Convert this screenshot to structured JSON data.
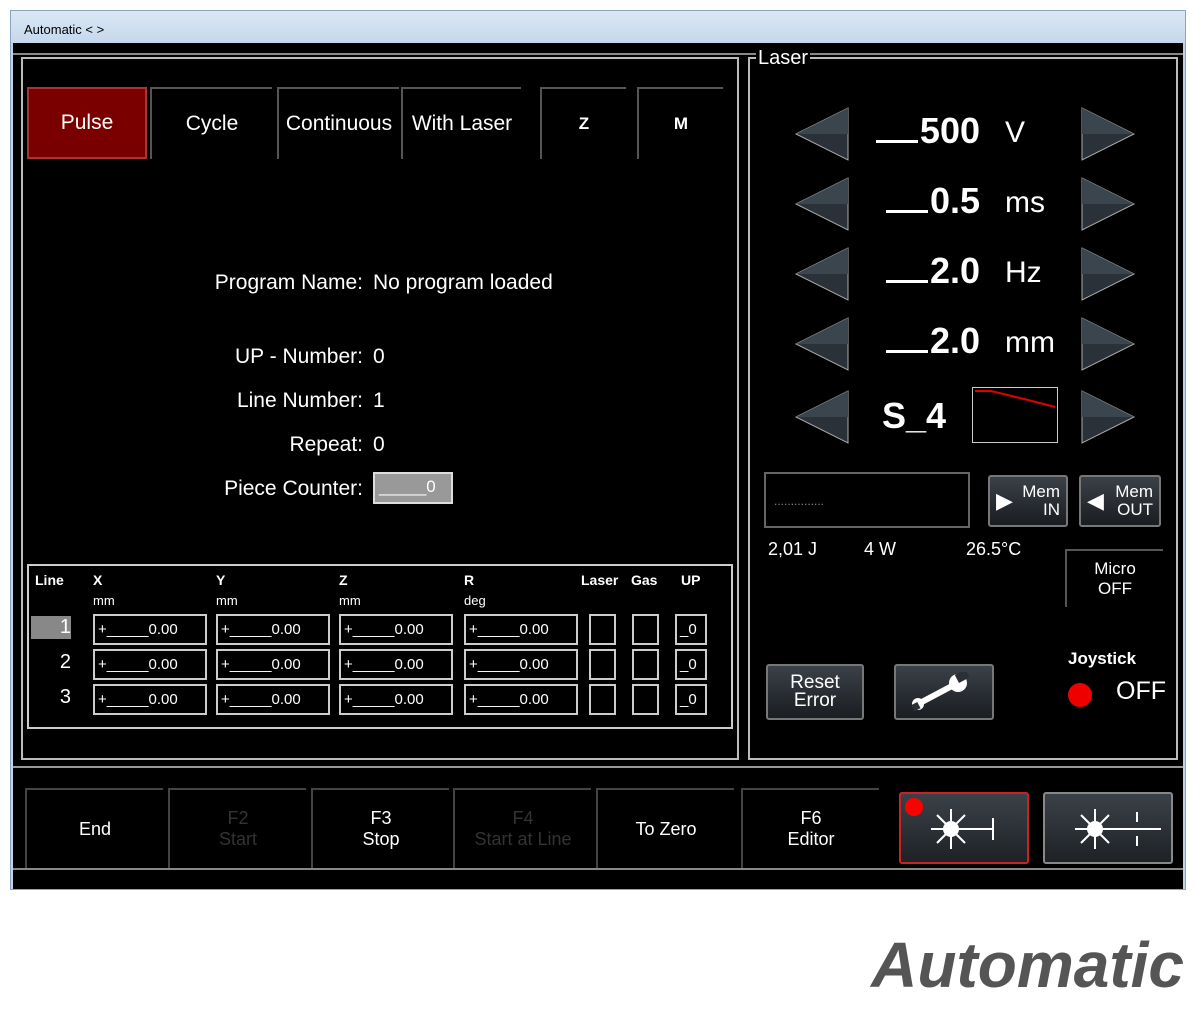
{
  "window": {
    "title": "Automatic < >"
  },
  "tabs": [
    {
      "label": "Pulse",
      "active": true
    },
    {
      "label": "Cycle"
    },
    {
      "label": "Continuous"
    },
    {
      "label": "With Laser"
    },
    {
      "label": "Z"
    },
    {
      "label": "M"
    }
  ],
  "info": {
    "program_name_label": "Program Name:",
    "program_name": "No program loaded",
    "up_number_label": "UP - Number:",
    "up_number": "0",
    "line_number_label": "Line Number:",
    "line_number": "1",
    "repeat_label": "Repeat:",
    "repeat": "0",
    "piece_counter_label": "Piece Counter:",
    "piece_counter": "_____0"
  },
  "table": {
    "headers": [
      "Line",
      "X",
      "Y",
      "Z",
      "R",
      "Laser",
      "Gas",
      "UP"
    ],
    "units": [
      "mm",
      "mm",
      "mm",
      "deg"
    ],
    "rows": [
      {
        "line": "1",
        "x": "+_____0.00",
        "y": "+_____0.00",
        "z": "+_____0.00",
        "r": "+_____0.00",
        "up": "_0",
        "selected": true
      },
      {
        "line": "2",
        "x": "+_____0.00",
        "y": "+_____0.00",
        "z": "+_____0.00",
        "r": "+_____0.00",
        "up": "_0"
      },
      {
        "line": "3",
        "x": "+_____0.00",
        "y": "+_____0.00",
        "z": "+_____0.00",
        "r": "+_____0.00",
        "up": "_0"
      }
    ]
  },
  "laser": {
    "title": "Laser",
    "params": [
      {
        "value": "500",
        "unit": "V"
      },
      {
        "value": "0.5",
        "unit": "ms"
      },
      {
        "value": "2.0",
        "unit": "Hz"
      },
      {
        "value": "2.0",
        "unit": "mm"
      }
    ],
    "shape": "S_4",
    "shape_curve_color": "#e00000",
    "display_text": "...............",
    "mem_in": [
      "Mem",
      "IN"
    ],
    "mem_out": [
      "Mem",
      "OUT"
    ],
    "energy": "2,01 J",
    "power": "4 W",
    "temperature": "26.5°C",
    "micro": [
      "Micro",
      "OFF"
    ],
    "reset_error": [
      "Reset",
      "Error"
    ],
    "joystick_label": "Joystick",
    "joystick_state": "OFF",
    "joystick_color": "#ee0000"
  },
  "footer": [
    {
      "label": [
        "End"
      ]
    },
    {
      "label": [
        "F2",
        "Start"
      ],
      "disabled": true
    },
    {
      "label": [
        "F3",
        "Stop"
      ]
    },
    {
      "label": [
        "F4",
        "Start at Line"
      ],
      "disabled": true
    },
    {
      "label": [
        "To Zero"
      ]
    },
    {
      "label": [
        "F6",
        "Editor"
      ]
    }
  ],
  "caption": "Automatic"
}
